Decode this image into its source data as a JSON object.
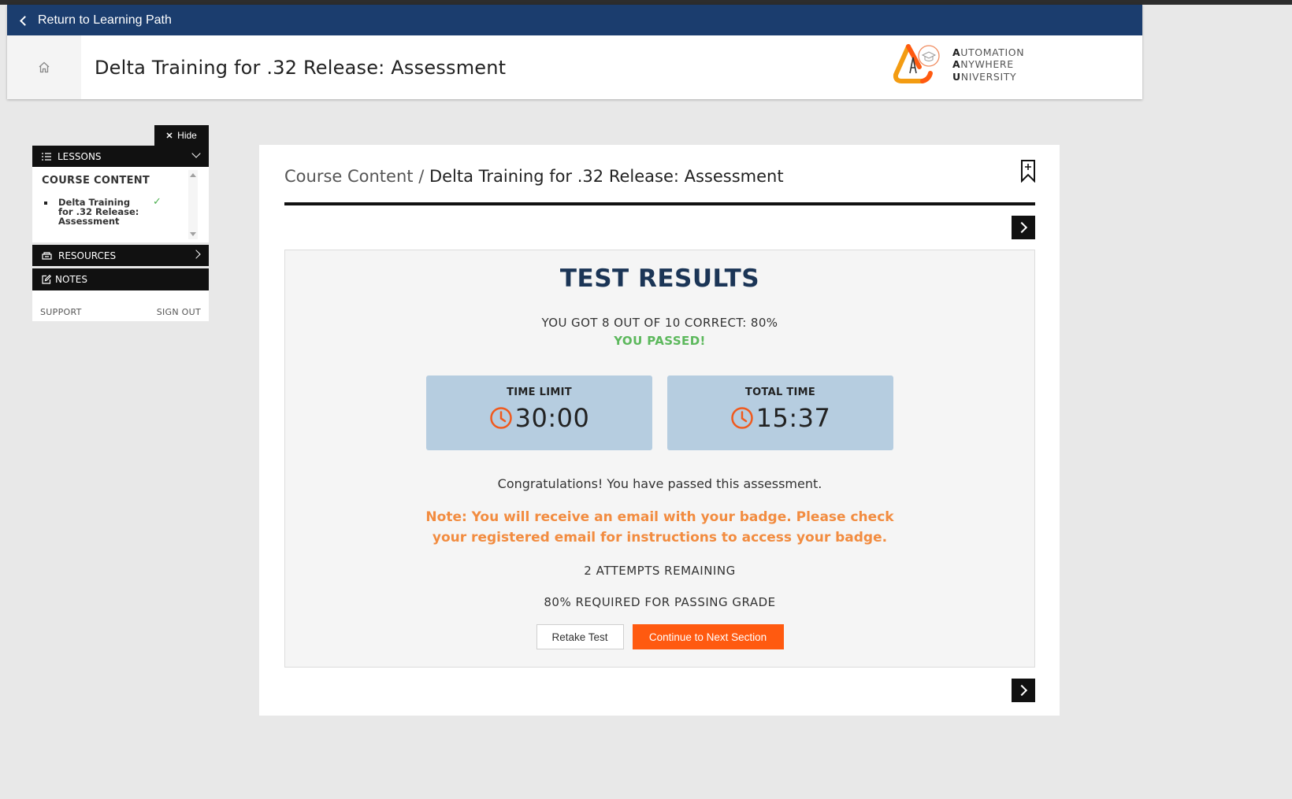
{
  "header": {
    "return_label": "Return to Learning Path",
    "page_title": "Delta Training for .32 Release: Assessment",
    "logo_lines": [
      {
        "initial": "A",
        "rest": "UTOMATION"
      },
      {
        "initial": "A",
        "rest": "NYWHERE"
      },
      {
        "initial": "U",
        "rest": "NIVERSITY"
      }
    ]
  },
  "sidebar": {
    "hide_label": "Hide",
    "lessons_label": "LESSONS",
    "course_content_label": "COURSE CONTENT",
    "lesson_items": [
      {
        "label": "Delta Training for .32 Release: Assessment",
        "completed": true
      }
    ],
    "resources_label": "RESOURCES",
    "notes_label": "NOTES",
    "support_label": "SUPPORT",
    "signout_label": "SIGN OUT"
  },
  "content": {
    "breadcrumb_link": "Course Content",
    "breadcrumb_separator": " / ",
    "breadcrumb_current": "Delta Training for .32 Release: Assessment"
  },
  "results": {
    "title": "TEST RESULTS",
    "score_line": "YOU GOT 8 OUT OF 10 CORRECT: 80%",
    "passed_line": "YOU PASSED!",
    "time_limit_label": "TIME LIMIT",
    "time_limit_value": "30:00",
    "total_time_label": "TOTAL TIME",
    "total_time_value": "15:37",
    "congrats": "Congratulations! You have passed this assessment.",
    "note": "Note: You will receive an email with your badge. Please check your registered email for instructions to access your badge.",
    "attempts": "2 ATTEMPTS REMAINING",
    "required": "80% REQUIRED FOR PASSING GRADE",
    "retake_label": "Retake Test",
    "continue_label": "Continue to Next Section"
  },
  "colors": {
    "header_navy": "#1b3d6e",
    "accent_orange": "#ff5a10",
    "pass_green": "#5cb85c",
    "note_orange": "#f28c40",
    "time_box_blue": "#b6cde0",
    "clock_orange": "#f05a1e"
  },
  "icons": {
    "home": "home-icon",
    "close": "close-icon",
    "list": "list-icon",
    "resources": "resources-icon",
    "notes": "edit-icon",
    "bookmark": "bookmark-plus-icon",
    "clock": "clock-icon",
    "check": "check-icon",
    "next": "chevron-right-icon"
  }
}
